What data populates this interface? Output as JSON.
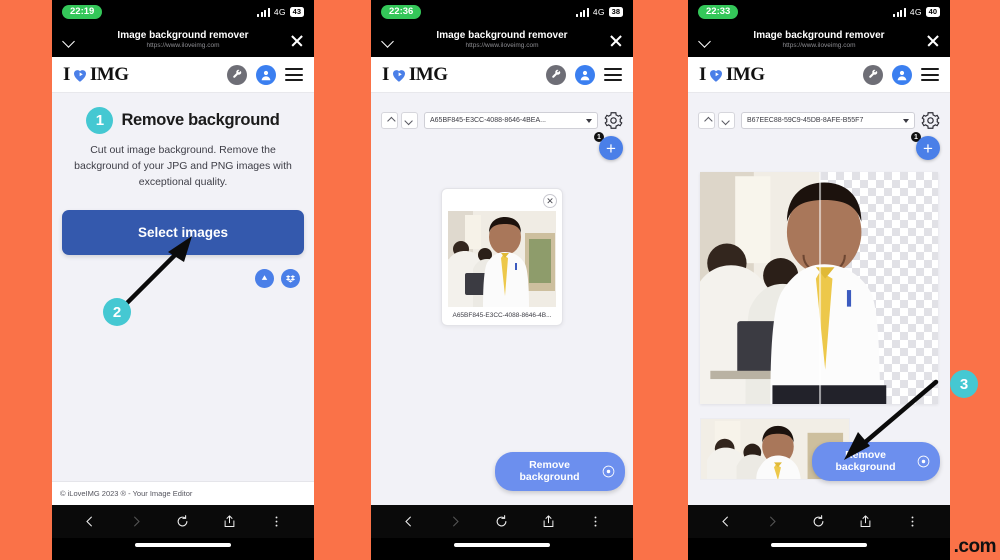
{
  "background_color": "#fa7248",
  "accent": {
    "step_badge": "#45c8d2",
    "primary_button": "#3459ad",
    "cta_button": "#6c8fee",
    "fab": "#4a7fe8",
    "avatar": "#3b7ff0"
  },
  "watermark": ".com",
  "browser_bar": {
    "title": "Image background remover",
    "url": "https://www.iloveimg.com",
    "collapse_icon": "chevron-down-icon",
    "close_icon": "close-icon"
  },
  "site_header": {
    "logo_prefix": "I",
    "logo_suffix": "IMG",
    "heart_icon": "heart-icon",
    "tools_icon": "wrench-icon",
    "account_icon": "user-avatar-icon",
    "menu_icon": "hamburger-menu-icon"
  },
  "bottom_nav": {
    "back_icon": "chevron-left-icon",
    "forward_icon": "chevron-right-icon",
    "reload_icon": "reload-icon",
    "share_icon": "share-icon",
    "more_icon": "more-vertical-icon"
  },
  "phones": [
    {
      "id": "phone-1",
      "status": {
        "time": "22:19",
        "network": "4G",
        "battery": "43"
      },
      "hero": {
        "step": "1",
        "title": "Remove background",
        "description": "Cut out image background. Remove the background of your JPG and PNG images with exceptional quality.",
        "primary_button": "Select images",
        "cloud_buttons": [
          {
            "name": "google-drive-button",
            "icon": "google-drive-icon"
          },
          {
            "name": "dropbox-button",
            "icon": "dropbox-icon"
          }
        ]
      },
      "footer": "© iLoveIMG 2023 ® - Your Image Editor",
      "annotation": {
        "step": "2"
      }
    },
    {
      "id": "phone-2",
      "status": {
        "time": "22:36",
        "network": "4G",
        "battery": "38"
      },
      "toolbar": {
        "prev_icon": "caret-up-icon",
        "next_icon": "caret-down-icon",
        "selected_file": "A65BF845-E3CC-4088-8646-4BEA...",
        "settings_icon": "gear-icon",
        "add_label": "+",
        "file_count": "1"
      },
      "file_card": {
        "remove_icon": "close-icon",
        "filename": "A65BF845-E3CC-4088-8646-4B..."
      },
      "cta": {
        "line1": "Remove",
        "line2": "background",
        "icon": "play-circle-icon"
      }
    },
    {
      "id": "phone-3",
      "status": {
        "time": "22:33",
        "network": "4G",
        "battery": "40"
      },
      "toolbar": {
        "prev_icon": "caret-up-icon",
        "next_icon": "caret-down-icon",
        "selected_file": "B67EEC88-59C9-45DB-8AFE-B55F7",
        "settings_icon": "gear-icon",
        "add_label": "+",
        "file_count": "1"
      },
      "cta": {
        "line1": "Remove",
        "line2": "background",
        "icon": "play-circle-icon"
      },
      "annotation": {
        "step": "3"
      }
    }
  ]
}
